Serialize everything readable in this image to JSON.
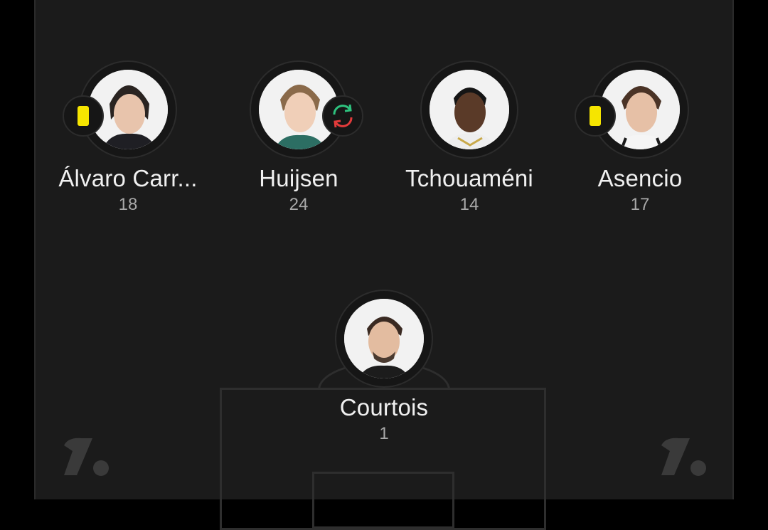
{
  "players": [
    {
      "name": "Álvaro Carr...",
      "number": "18",
      "badge": "yellow-card-icon"
    },
    {
      "name": "Huijsen",
      "number": "24",
      "badge": "substitution-icon"
    },
    {
      "name": "Tchouaméni",
      "number": "14",
      "badge": ""
    },
    {
      "name": "Asencio",
      "number": "17",
      "badge": "yellow-card-icon"
    }
  ],
  "goalkeeper": {
    "name": "Courtois",
    "number": "1"
  },
  "colors": {
    "pitch": "#1b1b1b",
    "yellow_card": "#f6e500",
    "sub_in": "#2ec27e",
    "sub_out": "#e23b3b"
  },
  "watermark": "onefootball-logo-icon"
}
